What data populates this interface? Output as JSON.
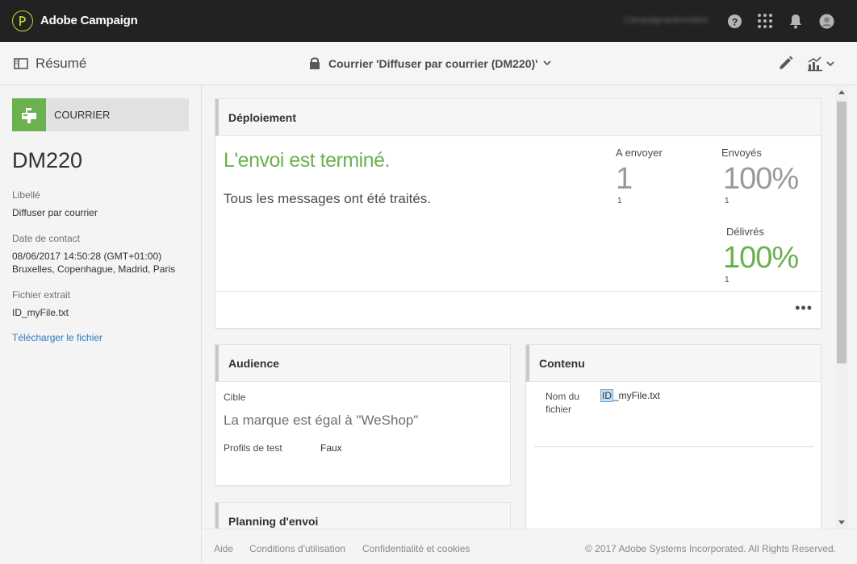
{
  "app": {
    "title": "Adobe Campaign",
    "user_name": "Campaignautomation"
  },
  "topbar": {
    "icons": [
      "help-icon",
      "apps-grid-icon",
      "bell-icon",
      "avatar-icon"
    ]
  },
  "subbar": {
    "resume_label": "Résumé",
    "delivery_title": "Courrier 'Diffuser par courrier (DM220)'"
  },
  "left": {
    "channel_label": "COURRIER",
    "code": "DM220",
    "libelle_label": "Libellé",
    "libelle_value": "Diffuser par courrier",
    "date_label": "Date de contact",
    "date_value_line1": "08/06/2017 14:50:28 (GMT+01:00)",
    "date_value_line2": "Bruxelles, Copenhague, Madrid, Paris",
    "file_label": "Fichier extrait",
    "file_value": "ID_myFile.txt",
    "download_link": "Télécharger le fichier"
  },
  "deployment": {
    "title": "Déploiement",
    "status": "L'envoi est terminé.",
    "description": "Tous les messages ont été traités.",
    "to_send_label": "A envoyer",
    "to_send_value": "1",
    "to_send_count": "1",
    "sent_label": "Envoyés",
    "sent_value": "100%",
    "sent_count": "1",
    "delivered_label": "Délivrés",
    "delivered_value": "100%",
    "delivered_count": "1",
    "more": "•••"
  },
  "audience": {
    "title": "Audience",
    "target_label": "Cible",
    "target_value": "La marque est égal à \"WeShop\"",
    "test_label": "Profils de test",
    "test_value": "Faux"
  },
  "content": {
    "title": "Contenu",
    "filename_label_1": "Nom du",
    "filename_label_2": "fichier",
    "filename_hl": "ID",
    "filename_rest": "_myFile.txt"
  },
  "planning": {
    "title": "Planning d'envoi"
  },
  "footer": {
    "help": "Aide",
    "terms": "Conditions d'utilisation",
    "privacy": "Confidentialité et cookies",
    "copyright": "© 2017 Adobe Systems Incorporated. All Rights Reserved."
  },
  "colors": {
    "accent_green": "#6bb14f",
    "logo_lime": "#c3d62c",
    "link_blue": "#2d7bc1",
    "topbar": "#222222"
  }
}
